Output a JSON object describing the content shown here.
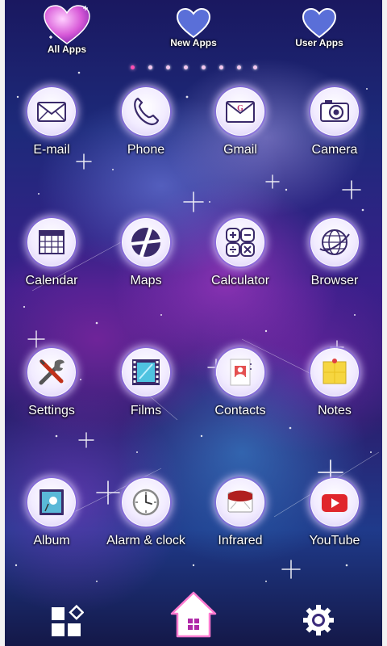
{
  "top_tabs": [
    {
      "label": "All Apps",
      "active": true
    },
    {
      "label": "New Apps",
      "active": false
    },
    {
      "label": "User Apps",
      "active": false
    }
  ],
  "page_indicator": {
    "count": 8,
    "active_index": 0
  },
  "apps": [
    {
      "label": "E-mail",
      "icon": "envelope-icon"
    },
    {
      "label": "Phone",
      "icon": "phone-handset-icon"
    },
    {
      "label": "Gmail",
      "icon": "gmail-envelope-icon"
    },
    {
      "label": "Camera",
      "icon": "camera-icon"
    },
    {
      "label": "Calendar",
      "icon": "calendar-icon"
    },
    {
      "label": "Maps",
      "icon": "map-road-icon"
    },
    {
      "label": "Calculator",
      "icon": "calculator-icon"
    },
    {
      "label": "Browser",
      "icon": "globe-icon"
    },
    {
      "label": "Settings",
      "icon": "wrench-screwdriver-icon"
    },
    {
      "label": "Films",
      "icon": "film-strip-icon"
    },
    {
      "label": "Contacts",
      "icon": "contact-card-icon"
    },
    {
      "label": "Notes",
      "icon": "sticky-note-icon"
    },
    {
      "label": "Album",
      "icon": "photo-album-icon"
    },
    {
      "label": "Alarm & clock",
      "icon": "clock-icon"
    },
    {
      "label": "Infrared",
      "icon": "infrared-icon"
    },
    {
      "label": "YouTube",
      "icon": "youtube-play-icon"
    }
  ],
  "dock": {
    "left_icon": "app-drawer-grid-icon",
    "center_icon": "home-icon",
    "right_icon": "settings-gear-icon"
  },
  "colors": {
    "accent_pink": "#ff4fb4",
    "heart_active": "#d85ad8",
    "heart_inactive": "#6a7fe0",
    "youtube_red": "#e0262b"
  }
}
